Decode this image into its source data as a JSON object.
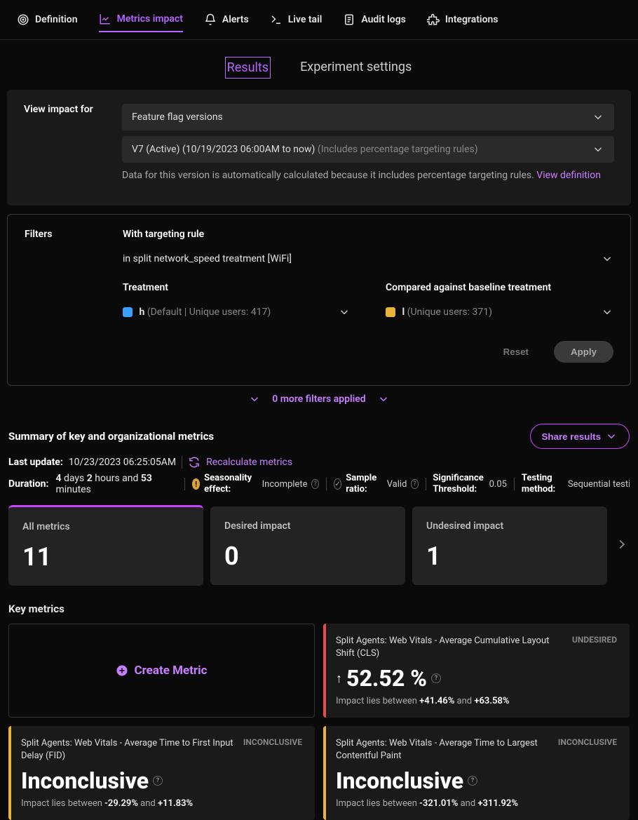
{
  "top_nav": {
    "definition": "Definition",
    "metrics_impact": "Metrics impact",
    "alerts": "Alerts",
    "live_tail": "Live tail",
    "audit_logs": "Audit logs",
    "integrations": "Integrations"
  },
  "sub_tabs": {
    "results": "Results",
    "experiment_settings": "Experiment settings"
  },
  "view_impact": {
    "label": "View impact for",
    "selector": "Feature flag versions",
    "version": "V7 (Active) (10/19/2023 06:00AM to now)",
    "version_note": "(Includes percentage targeting rules)",
    "info_text": "Data for this version is automatically calculated because it includes percentage targeting rules. ",
    "info_link": "View definition"
  },
  "filters": {
    "label": "Filters",
    "targeting_rule_label": "With targeting rule",
    "targeting_rule_value": "in split network_speed treatment [WiFi]",
    "treatment_label": "Treatment",
    "treatment_key": "h",
    "treatment_detail": "(Default | Unique users: 417)",
    "baseline_label": "Compared against baseline treatment",
    "baseline_key": "l",
    "baseline_detail": "(Unique users: 371)",
    "reset": "Reset",
    "apply": "Apply"
  },
  "more_filters": "0 more filters applied",
  "summary": {
    "title": "Summary of key and organizational metrics",
    "share": "Share results",
    "last_update_label": "Last update:",
    "last_update_value": "10/23/2023 06:25:05AM",
    "recalculate": "Recalculate metrics",
    "duration_label": "Duration:",
    "duration_value_1": "4",
    "duration_unit_1": "days",
    "duration_value_2": "2",
    "duration_unit_2": "hours and",
    "duration_value_3": "53",
    "duration_unit_3": "minutes",
    "seasonality_label": "Seasonality effect:",
    "seasonality_value": "Incomplete",
    "sample_ratio_label": "Sample ratio:",
    "sample_ratio_value": "Valid",
    "sig_threshold_label": "Significance Threshold:",
    "sig_threshold_value": "0.05",
    "testing_method_label": "Testing method:",
    "testing_method_value": "Sequential testing"
  },
  "counts": {
    "all_label": "All metrics",
    "all_value": "11",
    "desired_label": "Desired impact",
    "desired_value": "0",
    "undesired_label": "Undesired impact",
    "undesired_value": "1"
  },
  "key_metrics": {
    "title": "Key metrics",
    "create": "Create Metric",
    "cards": [
      {
        "name": "Split Agents: Web Vitals - Average Cumulative Layout Shift (CLS)",
        "badge": "UNDESIRED",
        "value": "52.52 %",
        "range_prefix": "Impact lies between ",
        "range_low": "+41.46%",
        "range_mid": " and ",
        "range_high": "+63.58%"
      },
      {
        "name": "Split Agents: Web Vitals - Average Time to First Input Delay (FID)",
        "badge": "INCONCLUSIVE",
        "value": "Inconclusive",
        "range_prefix": "Impact lies between ",
        "range_low": "-29.29%",
        "range_mid": " and ",
        "range_high": "+11.83%"
      },
      {
        "name": "Split Agents: Web Vitals - Average Time to Largest Contentful Paint",
        "badge": "INCONCLUSIVE",
        "value": "Inconclusive",
        "range_prefix": "Impact lies between ",
        "range_low": "-321.01%",
        "range_mid": " and ",
        "range_high": "+311.92%"
      }
    ]
  }
}
